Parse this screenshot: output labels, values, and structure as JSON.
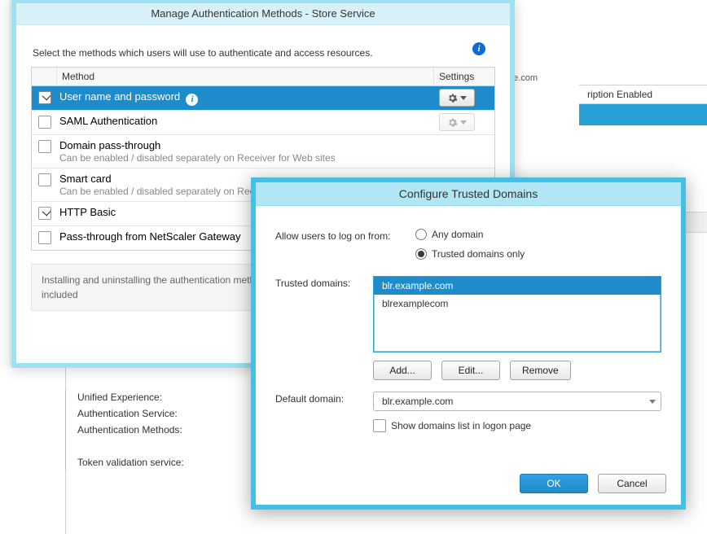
{
  "background": {
    "subscription_header": "ription Enabled",
    "float_label": "blr.example.com",
    "details": {
      "unified_experience": "Unified Experience:",
      "auth_service": "Authentication Service:",
      "auth_methods": "Authentication Methods:",
      "token_validation": "Token validation service:"
    }
  },
  "dialog1": {
    "title": "Manage Authentication Methods - Store Service",
    "intro": "Select the methods which users will use to authenticate and access resources.",
    "headers": {
      "method": "Method",
      "settings": "Settings"
    },
    "rows": {
      "r0": {
        "label": "User name and password"
      },
      "r1": {
        "label": "SAML Authentication"
      },
      "r2": {
        "label": "Domain pass-through",
        "sub": "Can be enabled / disabled separately on Receiver for Web sites"
      },
      "r3": {
        "label": "Smart card",
        "sub": "Can be enabled / disabled separately on Receiver for Web sites"
      },
      "r4": {
        "label": "HTTP Basic"
      },
      "r5": {
        "label": "Pass-through from NetScaler Gateway"
      }
    },
    "footer_note": "Installing and uninstalling the authentication methods and the authentication service settings are included"
  },
  "dialog2": {
    "title": "Configure Trusted Domains",
    "allow_label": "Allow users to log on from:",
    "radio_any": "Any domain",
    "radio_trusted": "Trusted domains only",
    "trusted_label": "Trusted domains:",
    "list": {
      "i0": "blr.example.com",
      "i1": "blrexamplecom"
    },
    "add": "Add...",
    "edit": "Edit...",
    "remove": "Remove",
    "default_label": "Default domain:",
    "default_value": "blr.example.com",
    "show_list_label": "Show domains list in logon page",
    "ok": "OK",
    "cancel": "Cancel"
  }
}
